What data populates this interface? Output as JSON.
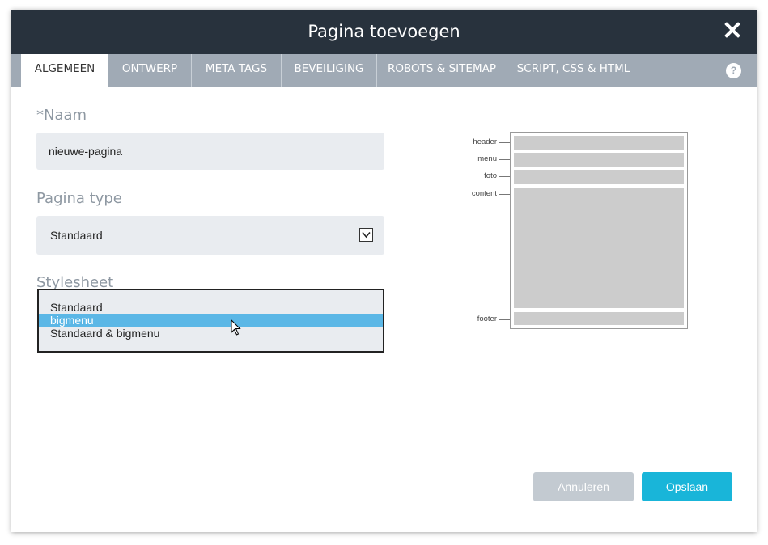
{
  "dialog": {
    "title": "Pagina toevoegen"
  },
  "tabs": [
    {
      "label": "ALGEMEEN",
      "active": true
    },
    {
      "label": "ONTWERP"
    },
    {
      "label": "META TAGS"
    },
    {
      "label": "BEVEILIGING"
    },
    {
      "label": "ROBOTS & SITEMAP"
    },
    {
      "label": "SCRIPT, CSS & HTML"
    }
  ],
  "help": "?",
  "form": {
    "name_required_marker": "*",
    "name_label": "Naam",
    "name_value": "nieuwe-pagina",
    "page_type_label": "Pagina type",
    "page_type_value": "Standaard",
    "stylesheet_label": "Stylesheet",
    "stylesheet_options": [
      "Standaard",
      "bigmenu",
      "Standaard & bigmenu"
    ],
    "stylesheet_selected": "bigmenu"
  },
  "layout_diagram": {
    "labels": [
      "header",
      "menu",
      "foto",
      "content",
      "footer"
    ]
  },
  "buttons": {
    "cancel": "Annuleren",
    "save": "Opslaan"
  },
  "colors": {
    "titlebar": "#28323d",
    "tabbar": "#a0aab5",
    "selected_option": "#5bb7e6",
    "save_button": "#19b5d9",
    "cancel_button": "#c3cad1"
  }
}
